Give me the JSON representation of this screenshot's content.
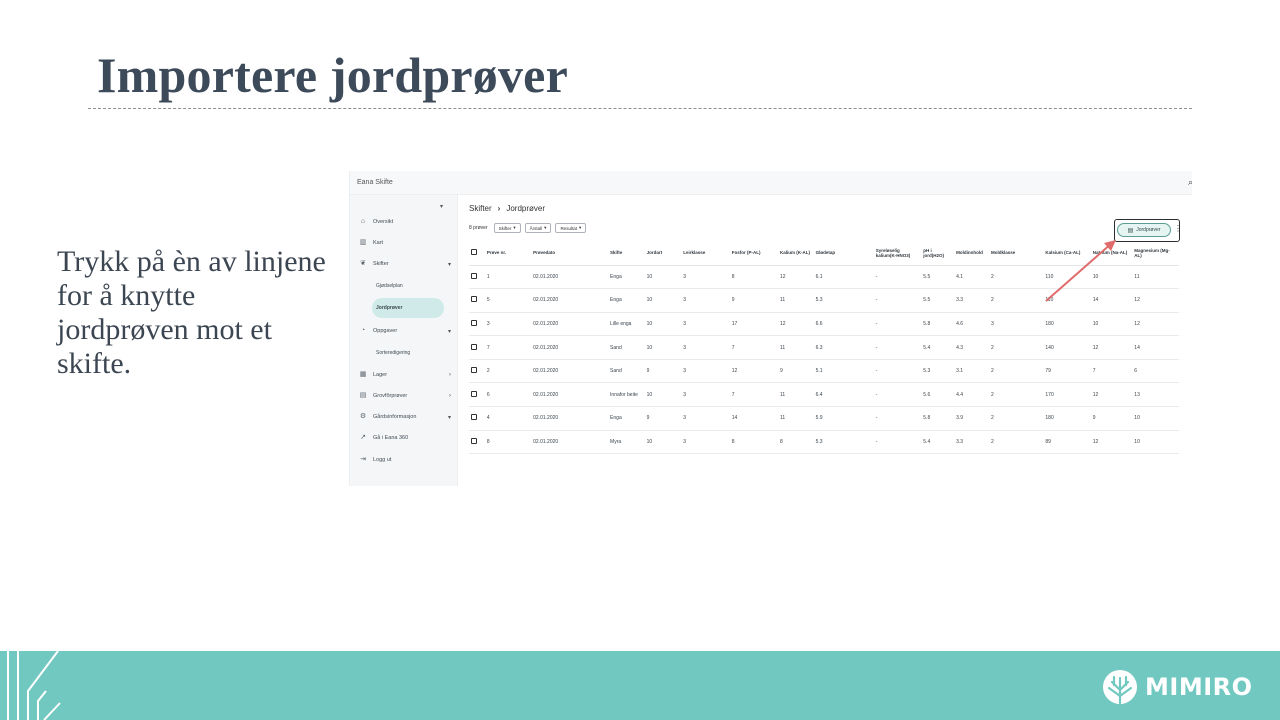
{
  "slide": {
    "title": "Importere jordprøver",
    "body": "Trykk på èn av linjene for å knytte jordprøven mot et skifte."
  },
  "app": {
    "name": "Eana Skifte",
    "sidebar": {
      "items": [
        {
          "label": "Oversikt",
          "icon": "home-icon"
        },
        {
          "label": "Kart",
          "icon": "map-icon"
        },
        {
          "label": "Skifter",
          "icon": "plant-icon",
          "caret": "▾"
        },
        {
          "label": "Gjødselplan",
          "sub": true
        },
        {
          "label": "Jordprøver",
          "sub": true,
          "active": true
        },
        {
          "label": "Oppgaver",
          "icon": "task-icon",
          "caret": "▾"
        },
        {
          "label": "Sorteredigering",
          "sub": true
        },
        {
          "label": "Lager",
          "icon": "warehouse-icon",
          "caret": "›"
        },
        {
          "label": "Grovfôrprøver",
          "icon": "feed-icon",
          "caret": "›"
        },
        {
          "label": "Gårdsinformasjon",
          "icon": "gear-icon",
          "caret": "▾"
        },
        {
          "label": "Gå i Eana 360",
          "icon": "external-link-icon"
        },
        {
          "label": "Logg ut",
          "icon": "logout-icon"
        }
      ]
    },
    "breadcrumb": {
      "root": "Skifter",
      "separator": "›",
      "current": "Jordprøver"
    },
    "filters": {
      "count": "8 prøver",
      "chips": [
        "Skifter",
        "Årstall",
        "Resultat"
      ]
    },
    "export_button": "Jordprøver",
    "table": {
      "headers": [
        "Prøve nr.",
        "Prøvedato",
        "Skifte",
        "Jordart",
        "Leirklasse",
        "Fosfor (P-AL)",
        "Kalium (K-AL)",
        "Glødetap",
        "Syreløselig kalium(K-HNO3)",
        "pH i jord(H2O)",
        "Moldinnhold",
        "Moldklasse",
        "Kalsium (Ca-AL)",
        "Natrium (Na-AL)",
        "Magnesium (Mg-AL)"
      ],
      "rows": [
        [
          "1",
          "02.01.2020",
          "Enga",
          "10",
          "3",
          "8",
          "12",
          "6.1",
          "-",
          "5.5",
          "4.1",
          "2",
          "110",
          "10",
          "11"
        ],
        [
          "5",
          "02.01.2020",
          "Enga",
          "10",
          "3",
          "9",
          "11",
          "5.3",
          "-",
          "5.5",
          "3.3",
          "2",
          "110",
          "14",
          "12"
        ],
        [
          "3",
          "02.01.2020",
          "Lille enga",
          "10",
          "3",
          "17",
          "12",
          "6.6",
          "-",
          "5.8",
          "4.6",
          "3",
          "180",
          "10",
          "12"
        ],
        [
          "7",
          "02.01.2020",
          "Sand",
          "10",
          "3",
          "7",
          "11",
          "6.3",
          "-",
          "5.4",
          "4.3",
          "2",
          "140",
          "12",
          "14"
        ],
        [
          "2",
          "02.01.2020",
          "Sand",
          "9",
          "3",
          "12",
          "9",
          "5.1",
          "-",
          "5.3",
          "3.1",
          "2",
          "79",
          "7",
          "6"
        ],
        [
          "6",
          "02.01.2020",
          "Innafor beite",
          "10",
          "3",
          "7",
          "11",
          "6.4",
          "-",
          "5.6",
          "4.4",
          "2",
          "170",
          "12",
          "13"
        ],
        [
          "4",
          "02.01.2020",
          "Enga",
          "9",
          "3",
          "14",
          "11",
          "5.9",
          "-",
          "5.8",
          "3.9",
          "2",
          "180",
          "9",
          "10"
        ],
        [
          "8",
          "02.01.2020",
          "Myra",
          "10",
          "3",
          "8",
          "8",
          "5.3",
          "-",
          "5.4",
          "3.3",
          "2",
          "89",
          "12",
          "10"
        ]
      ]
    }
  },
  "footer": {
    "brand": "MIMIRO",
    "color": "#71c8c0"
  }
}
